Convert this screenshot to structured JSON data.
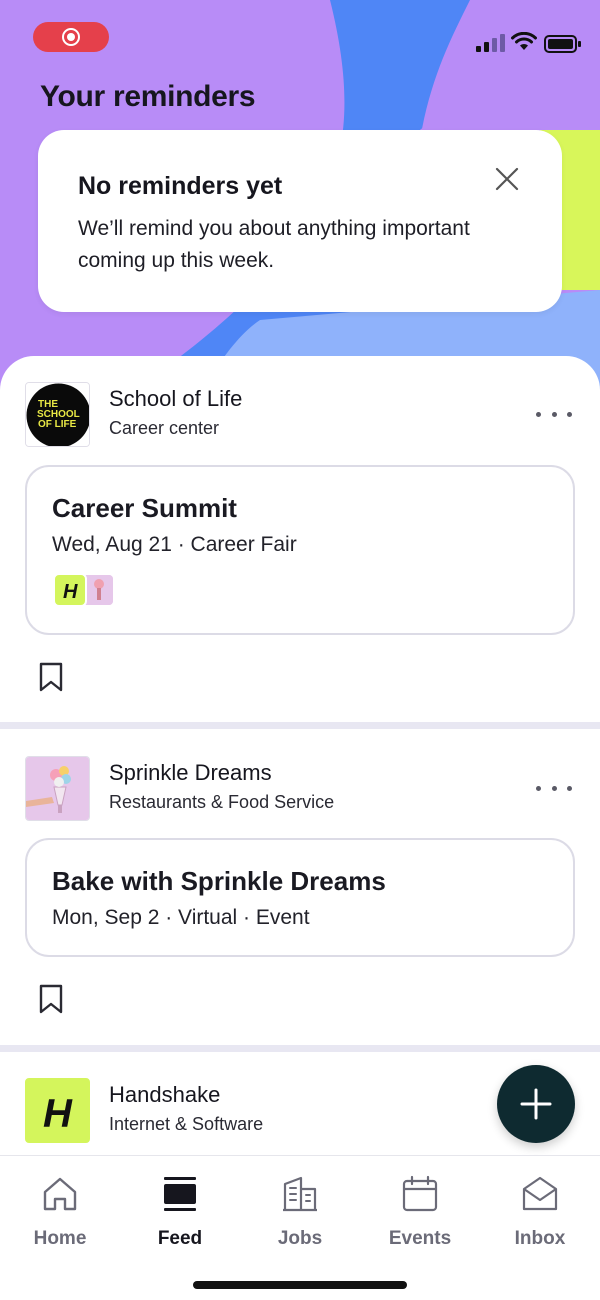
{
  "page": {
    "title": "Your reminders"
  },
  "reminder": {
    "title": "No reminders yet",
    "text": "We’ll remind you about anything important coming up this week."
  },
  "feed": [
    {
      "org_name": "School of Life",
      "org_category": "Career center",
      "logo_text": [
        "THE",
        "SCHOOL",
        "OF LIFE"
      ],
      "event_title": "Career Summit",
      "event_meta": "Wed, Aug 21 · Career Fair"
    },
    {
      "org_name": "Sprinkle Dreams",
      "org_category": "Restaurants & Food Service",
      "event_title": "Bake with Sprinkle Dreams",
      "event_meta": "Mon, Sep 2 · Virtual · Event"
    },
    {
      "org_name": "Handshake",
      "org_category": "Internet & Software",
      "logo_text": "H"
    }
  ],
  "attendee_logo_text": "H",
  "nav": [
    {
      "label": "Home",
      "icon": "home-icon",
      "active": false
    },
    {
      "label": "Feed",
      "icon": "feed-icon",
      "active": true
    },
    {
      "label": "Jobs",
      "icon": "building-icon",
      "active": false
    },
    {
      "label": "Events",
      "icon": "calendar-icon",
      "active": false
    },
    {
      "label": "Inbox",
      "icon": "envelope-icon",
      "active": false
    }
  ],
  "colors": {
    "hero_purple": "#b88cf7",
    "hero_blue": "#4f86f6",
    "hero_light_blue": "#8fb2fb",
    "hero_lime": "#d8f65a",
    "brand_lime": "#d4f55c",
    "fab_bg": "#0e2a30",
    "recording_red": "#e5404b"
  }
}
